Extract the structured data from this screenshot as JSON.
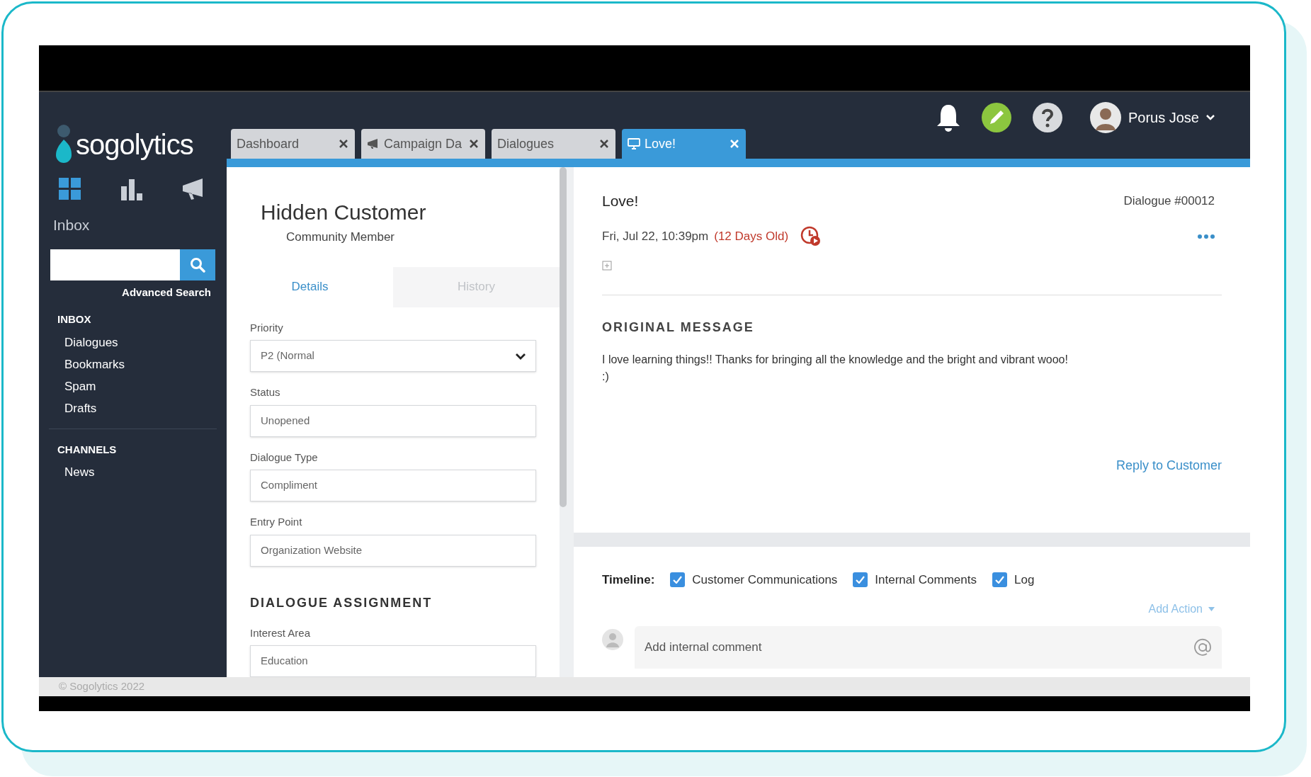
{
  "sidebar": {
    "logo": "sogolytics",
    "nav": [
      {
        "kind": "grid",
        "selected": true
      },
      {
        "kind": "chart",
        "selected": false
      },
      {
        "kind": "megaphone",
        "selected": false
      }
    ],
    "section_label": "Inbox",
    "advanced_search": "Advanced Search",
    "groups": [
      {
        "title": "INBOX",
        "items": [
          "Dialogues",
          "Bookmarks",
          "Spam",
          "Drafts"
        ]
      },
      {
        "title": "CHANNELS",
        "items": [
          "News"
        ]
      }
    ]
  },
  "tabs": [
    {
      "label": "Dashboard",
      "kind": "plain",
      "selected": false
    },
    {
      "label": "Campaign Da",
      "kind": "megaphone",
      "selected": false
    },
    {
      "label": "Dialogues",
      "kind": "plain",
      "selected": false
    },
    {
      "label": "Love!",
      "kind": "monitor",
      "selected": true
    }
  ],
  "user": {
    "name": "Porus Jose"
  },
  "customer": {
    "name": "Hidden Customer",
    "role": "Community Member"
  },
  "detail_tabs": [
    {
      "label": "Details",
      "selected": true
    },
    {
      "label": "History",
      "selected": false
    }
  ],
  "fields": [
    {
      "kind": "select",
      "label": "Priority",
      "value": "P2 (Normal"
    },
    {
      "kind": "text",
      "label": "Status",
      "value": "Unopened"
    },
    {
      "kind": "text",
      "label": "Dialogue Type",
      "value": "Compliment"
    },
    {
      "kind": "text",
      "label": "Entry Point",
      "value": "Organization Website"
    },
    {
      "kind": "heading",
      "label": "DIALOGUE ASSIGNMENT"
    },
    {
      "kind": "text",
      "label": "Interest Area",
      "value": "Education"
    }
  ],
  "dialogue": {
    "title": "Love!",
    "number": "Dialogue #00012",
    "date": "Fri, Jul 22, 10:39pm",
    "age": "(12 Days Old)",
    "section": "ORIGINAL MESSAGE",
    "message": [
      "I love learning things!! Thanks for bringing all the knowledge and the bright and vibrant wooo!",
      ":)"
    ],
    "reply": "Reply to Customer"
  },
  "timeline": {
    "label": "Timeline:",
    "options": [
      {
        "label": "Customer Communications",
        "checked": true
      },
      {
        "label": "Internal Comments",
        "checked": true
      },
      {
        "label": "Log",
        "checked": true
      }
    ],
    "add_action": "Add Action",
    "comment": {
      "placeholder": "Add internal comment"
    }
  },
  "footer": "© Sogolytics 2022"
}
